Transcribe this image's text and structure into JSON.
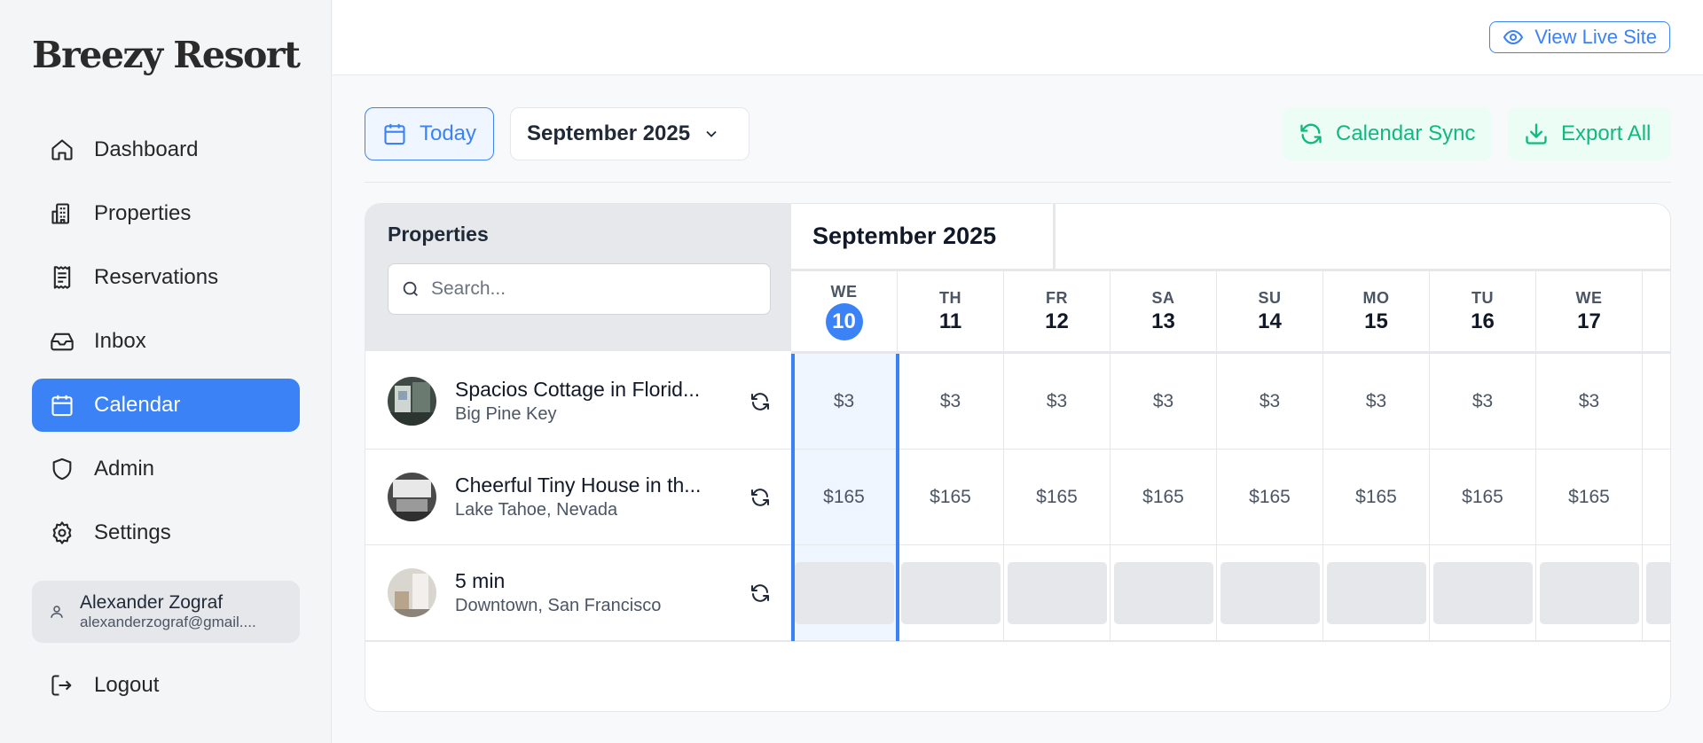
{
  "brand": "Breezy Resort",
  "sidebar": {
    "items": [
      {
        "label": "Dashboard",
        "icon": "home-icon"
      },
      {
        "label": "Properties",
        "icon": "building-icon"
      },
      {
        "label": "Reservations",
        "icon": "receipt-icon"
      },
      {
        "label": "Inbox",
        "icon": "inbox-icon"
      },
      {
        "label": "Calendar",
        "icon": "calendar-icon",
        "active": true
      },
      {
        "label": "Admin",
        "icon": "shield-icon"
      },
      {
        "label": "Settings",
        "icon": "gear-icon"
      }
    ],
    "user": {
      "name": "Alexander Zograf",
      "email": "alexanderzograf@gmail...."
    },
    "logout_label": "Logout"
  },
  "topbar": {
    "live_site_label": "View Live Site"
  },
  "toolbar": {
    "today_label": "Today",
    "month_select": "September 2025",
    "sync_label": "Calendar Sync",
    "export_label": "Export All"
  },
  "calendar": {
    "properties_header": "Properties",
    "search_placeholder": "Search...",
    "month_label": "September 2025",
    "days": [
      {
        "dow": "WE",
        "num": "10",
        "today": true
      },
      {
        "dow": "TH",
        "num": "11"
      },
      {
        "dow": "FR",
        "num": "12"
      },
      {
        "dow": "SA",
        "num": "13"
      },
      {
        "dow": "SU",
        "num": "14"
      },
      {
        "dow": "MO",
        "num": "15"
      },
      {
        "dow": "TU",
        "num": "16"
      },
      {
        "dow": "WE",
        "num": "17"
      }
    ],
    "properties": [
      {
        "name": "Spacios Cottage in Florid...",
        "location": "Big Pine Key",
        "prices": [
          "$3",
          "$3",
          "$3",
          "$3",
          "$3",
          "$3",
          "$3",
          "$3"
        ]
      },
      {
        "name": "Cheerful Tiny House in th...",
        "location": "Lake Tahoe, Nevada",
        "prices": [
          "$165",
          "$165",
          "$165",
          "$165",
          "$165",
          "$165",
          "$165",
          "$165"
        ]
      },
      {
        "name": "5 min",
        "location": "Downtown, San Francisco",
        "prices": [
          "",
          "",
          "",
          "",
          "",
          "",
          "",
          ""
        ]
      }
    ]
  },
  "colors": {
    "accent": "#3b82f6",
    "green": "#10b981",
    "green_bg": "#ecfdf5"
  }
}
